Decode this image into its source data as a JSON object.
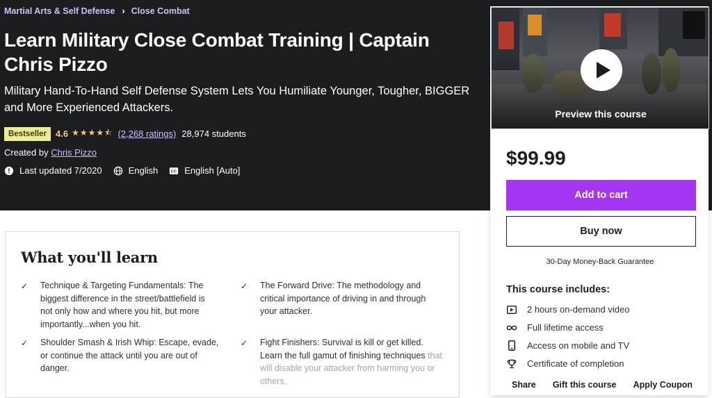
{
  "breadcrumb": {
    "items": [
      "Martial Arts & Self Defense",
      "Close Combat"
    ]
  },
  "course": {
    "title": "Learn Military Close Combat Training | Captain Chris Pizzo",
    "subtitle": "Military Hand-To-Hand Self Defense System Lets You Humiliate Younger, Tougher, BIGGER and More Experienced Attackers.",
    "badge": "Bestseller",
    "rating": "4.6",
    "stars": "★★★★⯪",
    "ratings_count": "(2,268 ratings)",
    "students": "28,974 students",
    "created_by_label": "Created by",
    "instructor": "Chris Pizzo",
    "last_updated": "Last updated 7/2020",
    "language": "English",
    "captions": "English [Auto]"
  },
  "learn": {
    "title": "What you'll learn",
    "items": [
      "Technique & Targeting Fundamentals: The biggest difference in the street/battlefield is not only how and where you hit, but more importantly...when you hit.",
      "The Forward Drive: The methodology and critical importance of driving in and through your attacker.",
      "Shoulder Smash & Irish Whip: Escape, evade, or continue the attack until you are out of danger.",
      "Fight Finishers: Survival is kill or get killed. Learn the full gamut of finishing techniques",
      "that will disable your attacker from harming you or others."
    ]
  },
  "sidebar": {
    "preview_label": "Preview this course",
    "price": "$99.99",
    "add_to_cart": "Add to cart",
    "buy_now": "Buy now",
    "guarantee": "30-Day Money-Back Guarantee",
    "includes_title": "This course includes:",
    "includes": [
      {
        "icon": "video-icon",
        "label": "2 hours on-demand video"
      },
      {
        "icon": "infinity-icon",
        "label": "Full lifetime access"
      },
      {
        "icon": "mobile-icon",
        "label": "Access on mobile and TV"
      },
      {
        "icon": "trophy-icon",
        "label": "Certificate of completion"
      }
    ],
    "actions": [
      "Share",
      "Gift this course",
      "Apply Coupon"
    ]
  },
  "colors": {
    "hero_bg": "#1c1d1f",
    "accent_purple": "#a435f0",
    "link_purple": "#cec0fc",
    "star_gold": "#f3ca8c",
    "badge_bg": "#eceb98"
  }
}
